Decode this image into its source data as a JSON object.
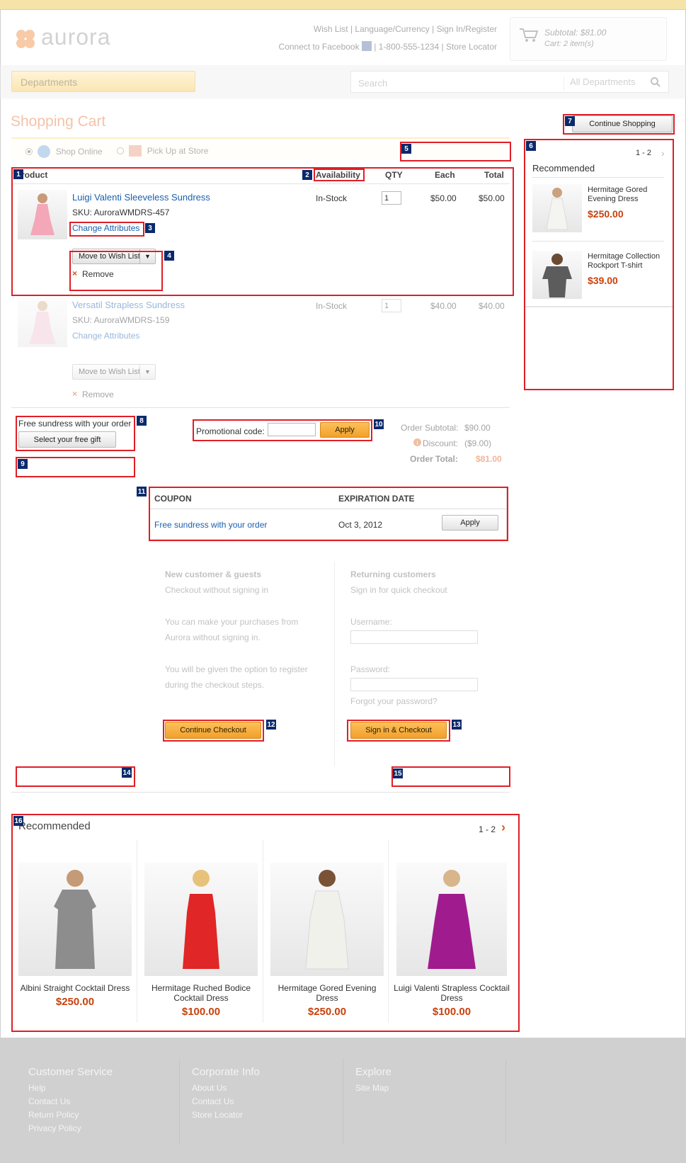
{
  "header": {
    "logo_text": "aurora",
    "links_row1": [
      "Wish List",
      "Language/Currency",
      "Sign In/Register"
    ],
    "links_row2": [
      "Connect to Facebook",
      "1-800-555-1234",
      "Store Locator"
    ],
    "mini_cart": {
      "subtotal": "Subtotal: $81.00",
      "count": "Cart: 2 item(s)"
    },
    "departments_label": "Departments",
    "search_placeholder": "Search",
    "search_scope": "All Departments"
  },
  "page_title": "Shopping Cart",
  "continue_shopping": "Continue Shopping",
  "shipping_options": [
    "Shop Online",
    "Pick Up at Store"
  ],
  "table_headers": {
    "product": "Product",
    "availability": "Availability",
    "qty": "QTY",
    "each": "Each",
    "total": "Total"
  },
  "cart_items": [
    {
      "name": "Luigi Valenti Sleeveless Sundress",
      "sku": "SKU: AuroraWMDRS-457",
      "change": "Change Attributes",
      "availability": "In-Stock",
      "qty": "1",
      "each": "$50.00",
      "total": "$50.00",
      "wish_list": "Move to Wish List",
      "remove": "Remove"
    },
    {
      "name": "Versatil Strapless Sundress",
      "sku": "SKU: AuroraWMDRS-159",
      "change": "Change Attributes",
      "availability": "In-Stock",
      "qty": "1",
      "each": "$40.00",
      "total": "$40.00",
      "wish_list": "Move to Wish List",
      "remove": "Remove"
    }
  ],
  "promotion": {
    "free_gift_text": "Free sundress with your order",
    "free_gift_button": "Select your free gift",
    "promo_label": "Promotional code:",
    "apply": "Apply"
  },
  "totals": {
    "subtotal_label": "Order Subtotal:",
    "subtotal": "$90.00",
    "discount_label": "Discount:",
    "discount": "($9.00)",
    "total_label": "Order Total:",
    "total": "$81.00"
  },
  "coupons": {
    "headers": [
      "COUPON",
      "EXPIRATION DATE"
    ],
    "rows": [
      {
        "name": "Free sundress with your order",
        "expires": "Oct 3, 2012",
        "action": "Apply"
      }
    ]
  },
  "checkout": {
    "new_title": "New customer & guests",
    "new_sub": "Checkout without signing in",
    "new_p1a": "You can make your purchases from",
    "new_p1b": "Aurora without signing in.",
    "new_p2a": "You will be given the option to register",
    "new_p2b": "during the checkout steps.",
    "continue_button": "Continue Checkout",
    "ret_title": "Returning customers",
    "ret_sub": "Sign in for quick checkout",
    "username_label": "Username:",
    "password_label": "Password:",
    "forgot": "Forgot your password?",
    "signin_button": "Sign in & Checkout"
  },
  "sidebar_recommended": {
    "title": "Recommended",
    "paging": "1 - 2",
    "items": [
      {
        "name_l1": "Hermitage Gored",
        "name_l2": "Evening Dress",
        "price": "$250.00"
      },
      {
        "name_l1": "Hermitage Collection",
        "name_l2": "Rockport T-shirt",
        "price": "$39.00"
      }
    ]
  },
  "bottom_recommended": {
    "title": "Recommended",
    "paging": "1 - 2",
    "items": [
      {
        "name_l1": "Albini Straight Cocktail Dress",
        "name_l2": "",
        "price": "$250.00"
      },
      {
        "name_l1": "Hermitage Ruched Bodice",
        "name_l2": "Cocktail Dress",
        "price": "$100.00"
      },
      {
        "name_l1": "Hermitage Gored Evening",
        "name_l2": "Dress",
        "price": "$250.00"
      },
      {
        "name_l1": "Luigi Valenti Strapless Cocktail",
        "name_l2": "Dress",
        "price": "$100.00"
      }
    ]
  },
  "footer": {
    "columns": [
      {
        "title": "Customer Service",
        "links": [
          "Help",
          "Contact Us",
          "Return Policy",
          "Privacy Policy"
        ]
      },
      {
        "title": "Corporate Info",
        "links": [
          "About Us",
          "Contact Us",
          "Store Locator"
        ]
      },
      {
        "title": "Explore",
        "links": [
          "Site Map"
        ]
      }
    ]
  },
  "annotations": [
    "1",
    "2",
    "3",
    "4",
    "5",
    "6",
    "7",
    "8",
    "9",
    "10",
    "11",
    "12",
    "13",
    "14",
    "15",
    "16"
  ],
  "colors": {
    "accent_orange": "#f2a02a",
    "price": "#c8410c",
    "link": "#1a5fae",
    "annotation_red": "#e01f26",
    "tag_navy": "#0a2a6b"
  }
}
